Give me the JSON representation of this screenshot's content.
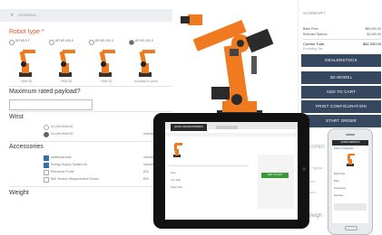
{
  "config": {
    "section_title": "GENERAL",
    "robot_type_label": "Robot type *",
    "robot_options": [
      {
        "name": "KR 60-3 F",
        "price": "+$90.00",
        "selected": false
      },
      {
        "name": "KR 60 L45-3",
        "price": "+$90.00",
        "selected": false
      },
      {
        "name": "KR 60 L30-3",
        "price": "+$90.00",
        "selected": false
      },
      {
        "name": "KR 60 L30-3",
        "price": "Included in price",
        "selected": true
      }
    ],
    "payload_label": "Maximum rated payload?",
    "payload_value": "",
    "wrist_label": "Wrist",
    "wrist_options": [
      {
        "name": "In-Line Wrist 60",
        "note": "",
        "selected": false
      },
      {
        "name": "In-Line Wrist 90",
        "note": "Included in p",
        "selected": true
      }
    ],
    "accessories_label": "Accessories",
    "accessories": [
      {
        "name": "Additional Axis",
        "note": "Included in",
        "checked": true
      },
      {
        "name": "Energy Supply System kit",
        "note": "Included in",
        "checked": true
      },
      {
        "name": "Electronic Probe",
        "note": "$20",
        "checked": false
      },
      {
        "name": "Belt Tension Measurement Device",
        "note": "$00",
        "checked": false
      }
    ],
    "weight_label": "Weight"
  },
  "summary": {
    "title": "SUMMARY",
    "rows": [
      {
        "label": "Base Price",
        "value": "$80,000.00"
      },
      {
        "label": "Selected Options",
        "value": "$2,000.00"
      }
    ],
    "total_label": "Current Total",
    "total_value": "$82,330.00",
    "total_note": "Excluding Tax",
    "buttons": [
      "DEALERSTOCK",
      "3D MODEL",
      "ADD TO CART",
      "PRINT CONFIGURATION",
      "START ORDER"
    ]
  },
  "background": {
    "heading_fragment": "ROPED",
    "rows": [
      "Li Types",
      "ions",
      "ions"
    ],
    "footer_fragment": "Weigh"
  },
  "tablet": {
    "brand": "QUICK AND BACKWARDS",
    "side_labels": [
      "Size",
      "Left Rail",
      "Right Rail"
    ],
    "button": "ADD TO CART"
  },
  "phone": {
    "brand": "SUPER WEBSHOP",
    "heading": "Robot Configurator",
    "items": [
      "Robot Type",
      "Wrist",
      "Accessories",
      "Summary"
    ]
  },
  "colors": {
    "accent": "#e05a2b",
    "button": "#35485f",
    "robot_orange": "#ef7a1f"
  }
}
